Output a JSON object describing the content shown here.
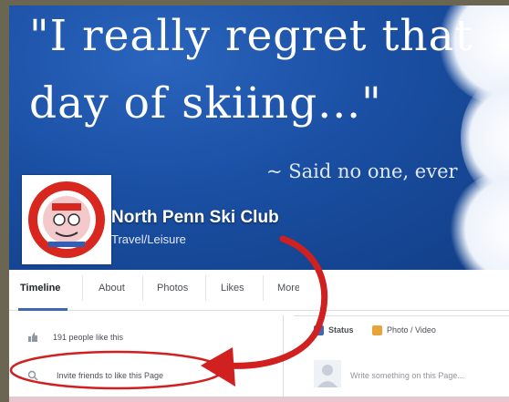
{
  "cover": {
    "quote_line1": "\"I really regret that",
    "quote_line2": "day of skiing...\"",
    "attribution": "~ Said no one, ever"
  },
  "page": {
    "name": "North Penn Ski Club",
    "category": "Travel/Leisure",
    "logo_label": "North Penn Ski Club"
  },
  "tabs": [
    {
      "label": "Timeline",
      "active": true
    },
    {
      "label": "About"
    },
    {
      "label": "Photos"
    },
    {
      "label": "Likes"
    },
    {
      "label": "More"
    }
  ],
  "sidebar": {
    "likes_text": "191 people like this",
    "invite_text": "Invite friends to like this Page"
  },
  "composer": {
    "status_label": "Status",
    "photo_label": "Photo / Video",
    "placeholder": "Write something on this Page..."
  },
  "colors": {
    "cover_blue": "#1a4fa3",
    "arrow_red": "#d0201f",
    "link_blue": "#4267b2"
  }
}
